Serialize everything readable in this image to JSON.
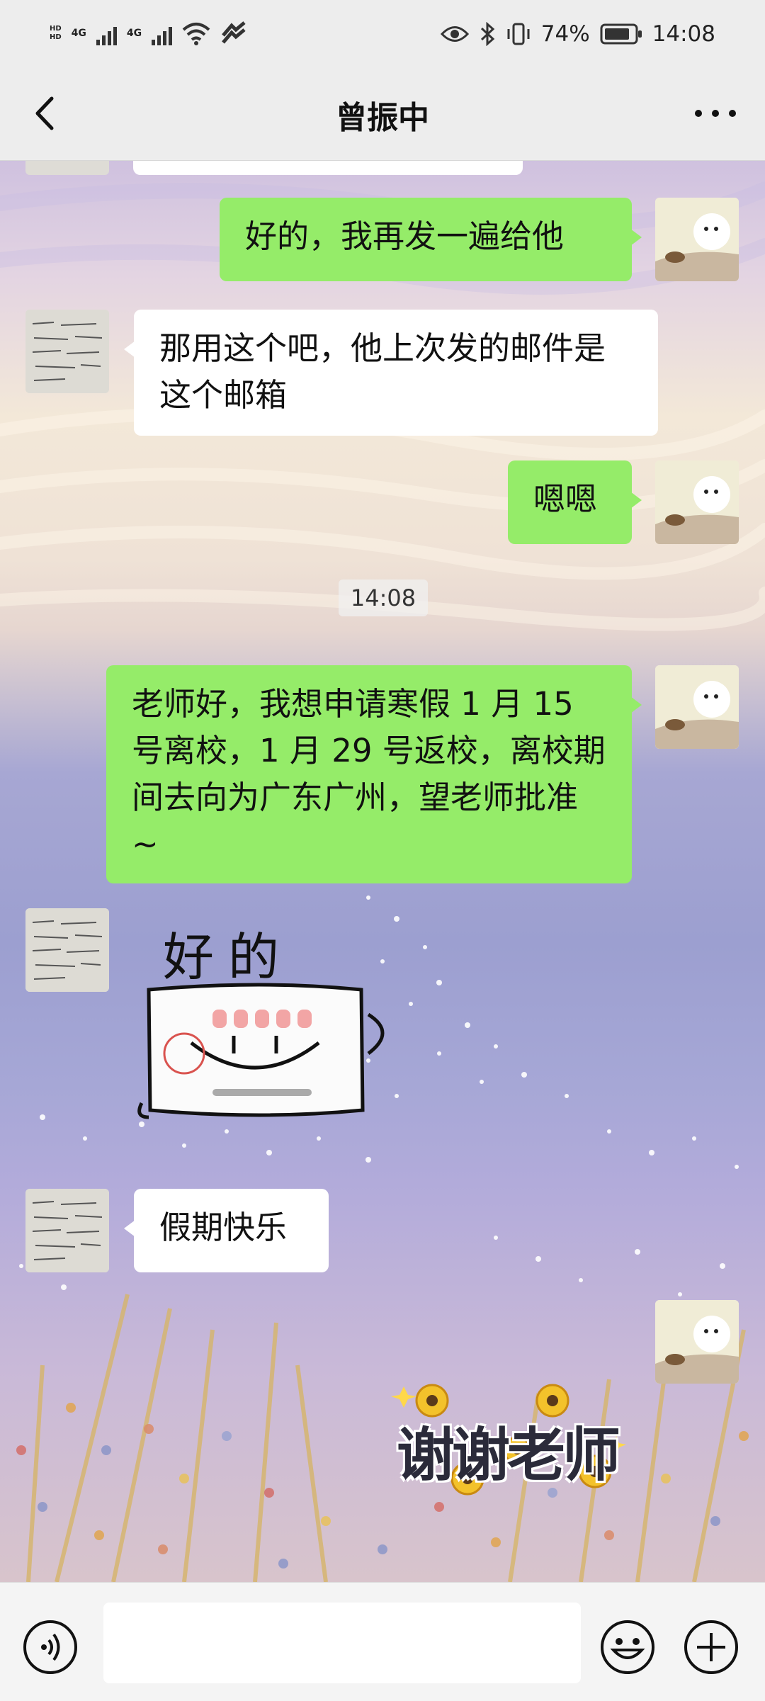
{
  "status_bar": {
    "hd_top": "HD",
    "hd_bottom": "HD",
    "network1": "4G",
    "network2": "4G",
    "battery": "74%",
    "time": "14:08"
  },
  "nav": {
    "title": "曾振中"
  },
  "messages": [
    {
      "side": "right",
      "text": "好的，我再发一遍给他"
    },
    {
      "side": "left",
      "text": "那用这个吧，他上次发的邮件是这个邮箱"
    },
    {
      "side": "right",
      "text": "嗯嗯"
    },
    {
      "timestamp": "14:08"
    },
    {
      "side": "right",
      "text": "老师好，我想申请寒假 1 月 15 号离校，1 月 29 号返校，离校期间去向为广东广州，望老师批准 ~"
    },
    {
      "side": "left",
      "sticker": "好的"
    },
    {
      "side": "left",
      "text": "假期快乐"
    },
    {
      "side": "right",
      "sticker": "谢谢老师"
    }
  ],
  "input_bar": {
    "voice_icon": "voice-icon",
    "emoji_icon": "emoji-icon",
    "plus_icon": "plus-icon",
    "value": ""
  },
  "colors": {
    "bubble_green": "#95ec69",
    "bubble_white": "#ffffff",
    "bar_bg": "#ededed"
  }
}
